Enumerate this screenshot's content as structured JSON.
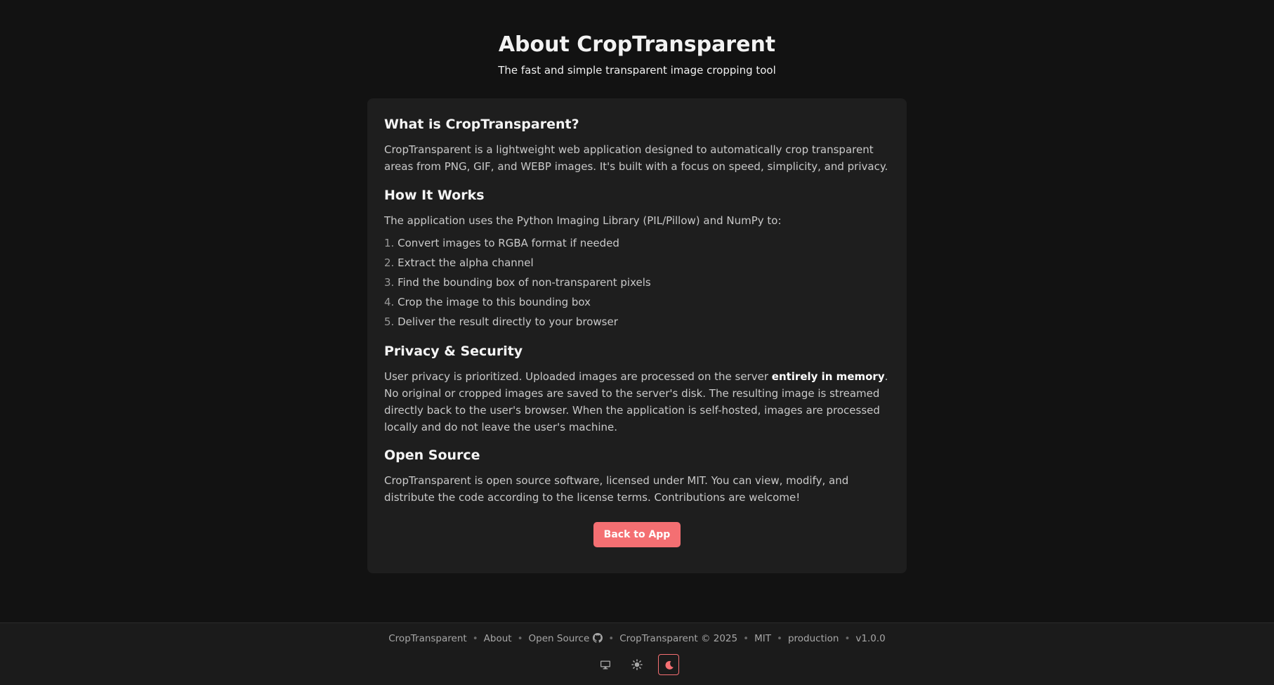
{
  "header": {
    "title": "About CropTransparent",
    "subtitle": "The fast and simple transparent image cropping tool"
  },
  "sections": {
    "what": {
      "heading": "What is CropTransparent?",
      "body": "CropTransparent is a lightweight web application designed to automatically crop transparent areas from PNG, GIF, and WEBP images. It's built with a focus on speed, simplicity, and privacy."
    },
    "how": {
      "heading": "How It Works",
      "intro": "The application uses the Python Imaging Library (PIL/Pillow) and NumPy to:",
      "steps": [
        {
          "num": "1.",
          "text": "Convert images to RGBA format if needed"
        },
        {
          "num": "2.",
          "text": "Extract the alpha channel"
        },
        {
          "num": "3.",
          "text": "Find the bounding box of non-transparent pixels"
        },
        {
          "num": "4.",
          "text": "Crop the image to this bounding box"
        },
        {
          "num": "5.",
          "text": "Deliver the result directly to your browser"
        }
      ]
    },
    "privacy": {
      "heading": "Privacy & Security",
      "before": "User privacy is prioritized. Uploaded images are processed on the server ",
      "emphasis": "entirely in memory",
      "after": ". No original or cropped images are saved to the server's disk. The resulting image is streamed directly back to the user's browser. When the application is self-hosted, images are processed locally and do not leave the user's machine."
    },
    "oss": {
      "heading": "Open Source",
      "body": "CropTransparent is open source software, licensed under MIT. You can view, modify, and distribute the code according to the license terms. Contributions are welcome!"
    }
  },
  "back_button": "Back to App",
  "footer": {
    "app_name": "CropTransparent",
    "about": "About",
    "open_source": "Open Source",
    "copyright": "CropTransparent © 2025",
    "license": "MIT",
    "environment": "production",
    "version": "v1.0.0",
    "separator": "•",
    "github_icon": "github-icon"
  },
  "theme_switch": {
    "options": [
      "system",
      "light",
      "dark"
    ],
    "selected": "dark",
    "icons": [
      "monitor-icon",
      "sun-icon",
      "moon-icon"
    ]
  },
  "colors": {
    "background": "#121212",
    "card": "#1e1e1e",
    "accent": "#f46f72",
    "footer": "#1b1b1b"
  }
}
